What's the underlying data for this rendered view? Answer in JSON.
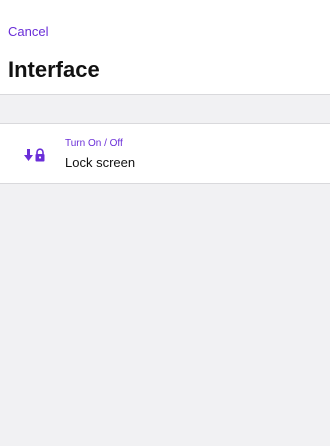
{
  "header": {
    "cancel_label": "Cancel",
    "title": "Interface"
  },
  "items": [
    {
      "subtitle": "Turn On / Off",
      "label": "Lock screen",
      "icon": "lock-down-icon"
    }
  ],
  "colors": {
    "accent": "#6a2ed8",
    "background": "#f1f1f3",
    "surface": "#ffffff",
    "separator": "#d9d9dc",
    "text": "#111111"
  }
}
